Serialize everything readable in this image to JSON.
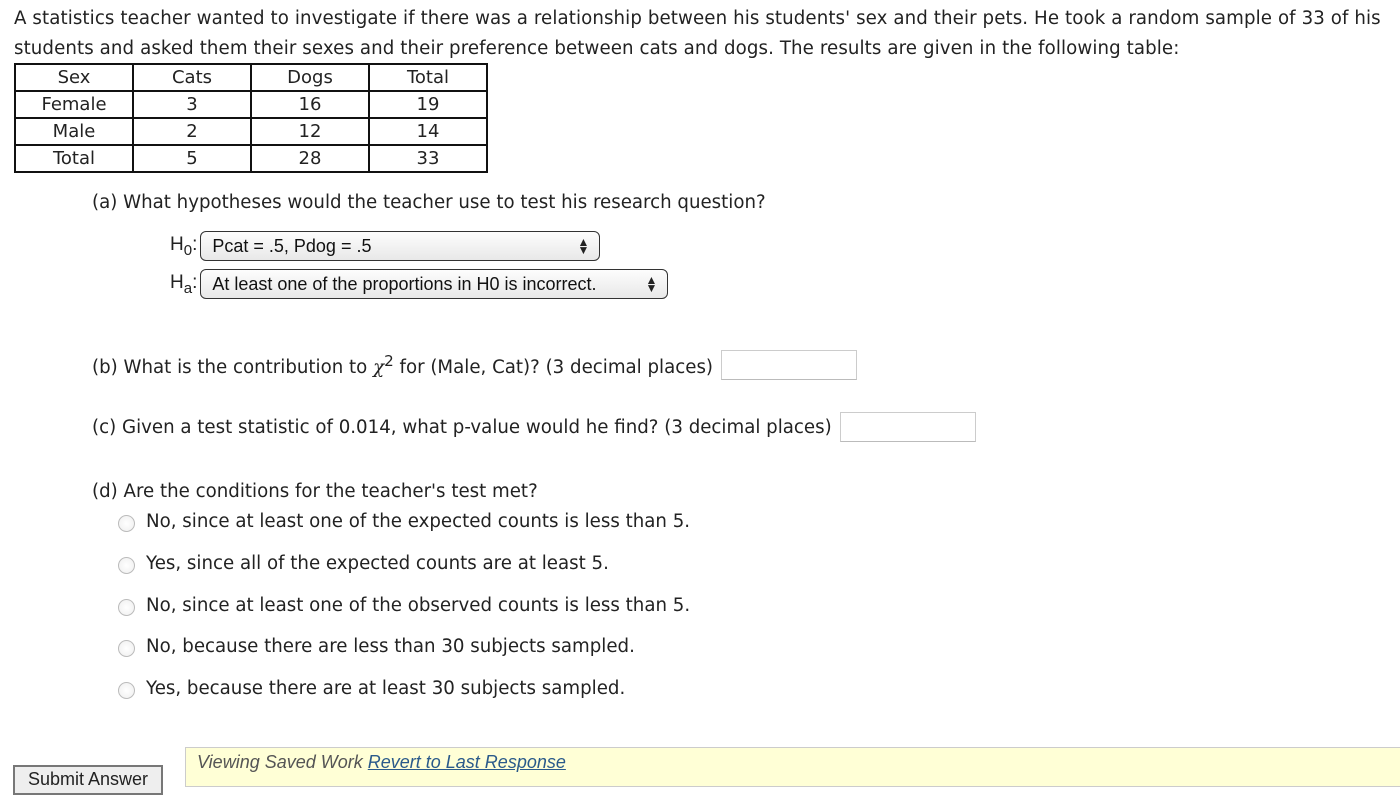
{
  "intro": "A statistics teacher wanted to investigate if there was a relationship between his students' sex and their pets. He took a random sample of 33 of his students and asked them their sexes and their preference between cats and dogs. The results are given in the following table:",
  "table": {
    "headers": [
      "Sex",
      "Cats",
      "Dogs",
      "Total"
    ],
    "rows": [
      [
        "Female",
        "3",
        "16",
        "19"
      ],
      [
        "Male",
        "2",
        "12",
        "14"
      ],
      [
        "Total",
        "5",
        "28",
        "33"
      ]
    ]
  },
  "part_a": {
    "question": "(a) What hypotheses would the teacher use to test his research question?",
    "h0_label": "H",
    "h0_sub": "0",
    "h0_value": "Pcat = .5, Pdog = .5",
    "ha_label": "H",
    "ha_sub": "a",
    "ha_value": "At least one of the proportions in H0 is incorrect."
  },
  "part_b": {
    "prefix": "(b) What is the contribution to ",
    "chi": "χ",
    "sup": "2",
    "suffix": " for (Male, Cat)? (3 decimal places)",
    "value": ""
  },
  "part_c": {
    "question": "(c) Given a test statistic of 0.014, what p-value would he find? (3 decimal places)",
    "value": ""
  },
  "part_d": {
    "question": "(d) Are the conditions for the teacher's test met?",
    "options": [
      "No, since at least one of the expected counts is less than 5.",
      "Yes, since all of the expected counts are at least 5.",
      "No, since at least one of the observed counts is less than 5.",
      "No, because there are less than 30 subjects sampled.",
      "Yes, because there are at least 30 subjects sampled."
    ]
  },
  "footer": {
    "submit_label": "Submit Answer",
    "saved_text": "Viewing Saved Work ",
    "revert_link": "Revert to Last Response"
  }
}
